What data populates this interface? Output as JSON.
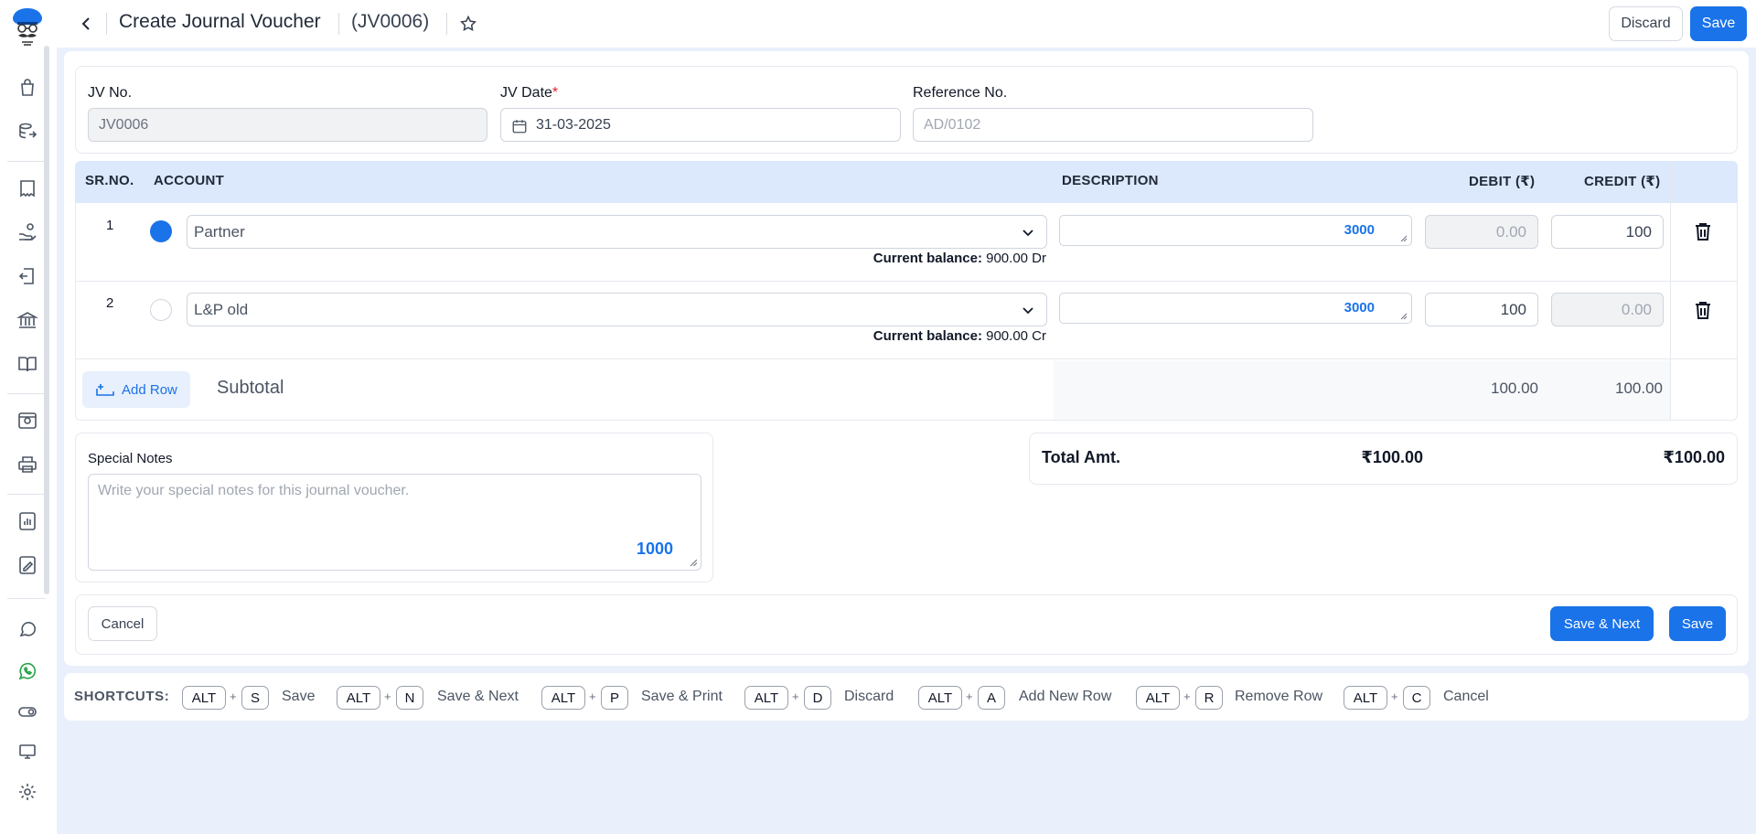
{
  "header": {
    "title": "Create Journal Voucher",
    "voucher_no": "(JV0006)",
    "discard_label": "Discard",
    "save_label": "Save"
  },
  "fields": {
    "jv_no": {
      "label": "JV No.",
      "value": "JV0006"
    },
    "jv_date": {
      "label": "JV Date",
      "required_mark": "*",
      "value": "31-03-2025"
    },
    "reference_no": {
      "label": "Reference No.",
      "placeholder": "AD/0102"
    }
  },
  "table": {
    "columns": [
      "SR.NO.",
      "ACCOUNT",
      "DESCRIPTION",
      "DEBIT (₹)",
      "CREDIT (₹)"
    ],
    "rows": [
      {
        "sr": "1",
        "selected": true,
        "account": "Partner",
        "balance_label": "Current balance:",
        "balance_value": "900.00 Dr",
        "desc_counter": "3000",
        "debit": "0.00",
        "credit": "100",
        "debit_disabled": true
      },
      {
        "sr": "2",
        "selected": false,
        "account": "L&P old",
        "balance_label": "Current balance:",
        "balance_value": "900.00 Cr",
        "desc_counter": "3000",
        "debit": "100",
        "credit": "0.00",
        "credit_disabled": true
      }
    ],
    "add_row_label": "Add Row",
    "subtotal_label": "Subtotal",
    "subtotal_debit": "100.00",
    "subtotal_credit": "100.00"
  },
  "notes": {
    "label": "Special Notes",
    "placeholder": "Write your special notes for this journal voucher.",
    "counter": "1000"
  },
  "totals": {
    "label": "Total Amt.",
    "debit": "₹100.00",
    "credit": "₹100.00"
  },
  "footer": {
    "cancel_label": "Cancel",
    "save_next_label": "Save & Next",
    "save_label": "Save"
  },
  "shortcuts": {
    "label": "SHORTCUTS:",
    "items": [
      {
        "mod": "ALT",
        "key": "S",
        "action": "Save"
      },
      {
        "mod": "ALT",
        "key": "N",
        "action": "Save & Next"
      },
      {
        "mod": "ALT",
        "key": "P",
        "action": "Save & Print"
      },
      {
        "mod": "ALT",
        "key": "D",
        "action": "Discard"
      },
      {
        "mod": "ALT",
        "key": "A",
        "action": "Add New Row"
      },
      {
        "mod": "ALT",
        "key": "R",
        "action": "Remove Row"
      },
      {
        "mod": "ALT",
        "key": "C",
        "action": "Cancel"
      }
    ]
  },
  "sidebar": {
    "icons": [
      "shopping-bag-icon",
      "stack-export-icon",
      "receipt-icon",
      "hand-coins-icon",
      "receipt-return-icon",
      "bank-icon",
      "book-open-icon",
      "settings-box-icon",
      "printer-icon",
      "report-icon",
      "document-edit-icon",
      "chat-icon",
      "whatsapp-icon",
      "toggle-icon",
      "monitor-icon",
      "gear-icon"
    ]
  },
  "colors": {
    "accent": "#1a73e8",
    "background": "#eaf0fb",
    "table_header": "#dce8fb",
    "whatsapp": "#25a244"
  }
}
